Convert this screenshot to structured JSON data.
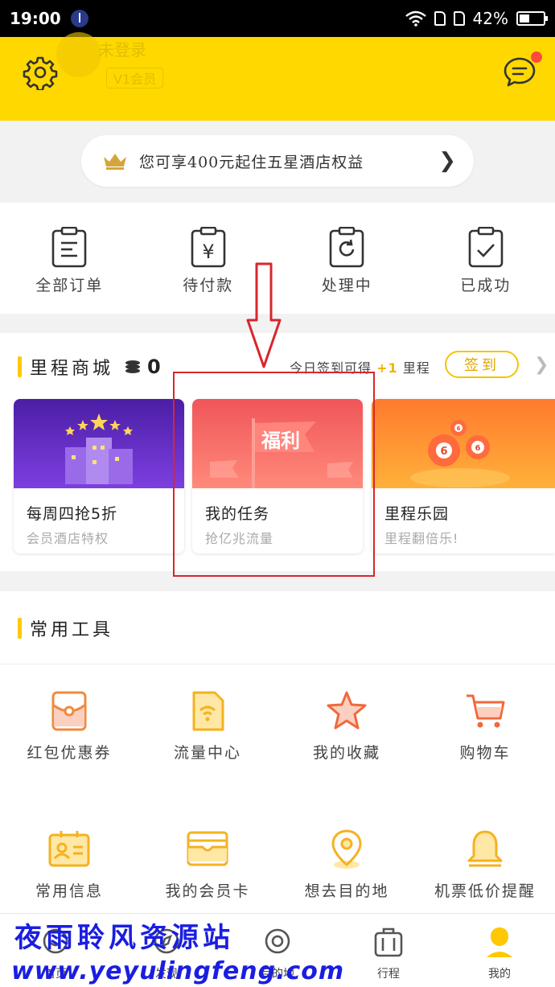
{
  "status_bar": {
    "time": "19:00",
    "battery": "42%"
  },
  "header": {
    "user_name": "未登录",
    "level": "V1会员"
  },
  "promo": {
    "text": "您可享400元起住五星酒店权益"
  },
  "orders": [
    {
      "label": "全部订单",
      "icon": "clipboard-list-icon"
    },
    {
      "label": "待付款",
      "icon": "clipboard-yen-icon"
    },
    {
      "label": "处理中",
      "icon": "clipboard-refresh-icon"
    },
    {
      "label": "已成功",
      "icon": "clipboard-check-icon"
    }
  ],
  "mall": {
    "title": "里程商城",
    "coins": "0",
    "checkin_prefix": "今日签到可得",
    "checkin_plus": "+1",
    "checkin_suffix": "里程",
    "checkin_button": "签到",
    "cards": [
      {
        "title": "每周四抢5折",
        "sub": "会员酒店特权"
      },
      {
        "title": "我的任务",
        "sub": "抢亿兆流量",
        "banner_text": "福利"
      },
      {
        "title": "里程乐园",
        "sub": "里程翻倍乐!"
      }
    ]
  },
  "tools": {
    "title": "常用工具",
    "items": [
      {
        "label": "红包优惠券",
        "icon": "red-envelope-icon"
      },
      {
        "label": "流量中心",
        "icon": "data-wifi-icon"
      },
      {
        "label": "我的收藏",
        "icon": "star-icon"
      },
      {
        "label": "购物车",
        "icon": "cart-icon"
      },
      {
        "label": "常用信息",
        "icon": "id-card-icon"
      },
      {
        "label": "我的会员卡",
        "icon": "member-card-icon"
      },
      {
        "label": "想去目的地",
        "icon": "location-pin-icon"
      },
      {
        "label": "机票低价提醒",
        "icon": "bell-icon"
      }
    ]
  },
  "nav": [
    {
      "label": "首页",
      "icon": "home-icon"
    },
    {
      "label": "发现",
      "icon": "compass-icon"
    },
    {
      "label": "目的地",
      "icon": "destination-icon"
    },
    {
      "label": "行程",
      "icon": "luggage-icon"
    },
    {
      "label": "我的",
      "icon": "profile-icon"
    }
  ],
  "watermark": {
    "line1": "夜雨聆风资源站",
    "line2": "www.yeyulingfeng.com"
  },
  "colors": {
    "brand_yellow": "#ffd800",
    "accent_orange": "#f5a623",
    "highlight_red": "#d8262d",
    "watermark_blue": "#1a1ee0"
  }
}
